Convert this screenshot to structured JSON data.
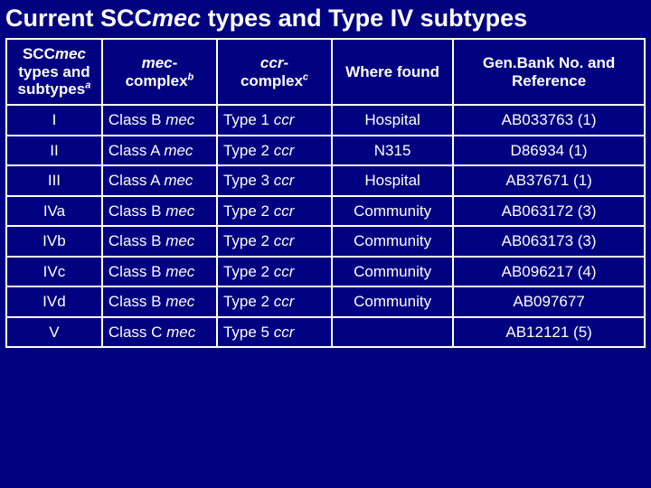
{
  "title": {
    "pre": "Current SCC",
    "mec": "mec",
    "post": " types and Type IV subtypes"
  },
  "headers": {
    "h0": {
      "pre": "SCC",
      "it": "mec",
      "br": "types and subtypes",
      "sup": "a"
    },
    "h1": {
      "it": "mec",
      "dash": "-",
      "line2": "complex",
      "sup": "b"
    },
    "h2": {
      "it": "ccr",
      "dash": "-",
      "line2": "complex",
      "sup": "c"
    },
    "h3": "Where found",
    "h4": "Gen.Bank No. and Reference"
  },
  "rows": [
    {
      "type": "I",
      "mec_class": "Class B",
      "ccr_type": "Type 1",
      "where": "Hospital",
      "ref": "AB033763 (1)"
    },
    {
      "type": "II",
      "mec_class": "Class A",
      "ccr_type": "Type 2",
      "where": "N315",
      "ref": "D86934 (1)"
    },
    {
      "type": "III",
      "mec_class": "Class A",
      "ccr_type": "Type 3",
      "where": "Hospital",
      "ref": "AB37671 (1)"
    },
    {
      "type": "IVa",
      "mec_class": "Class B",
      "ccr_type": "Type 2",
      "where": "Community",
      "ref": "AB063172 (3)"
    },
    {
      "type": "IVb",
      "mec_class": "Class B",
      "ccr_type": "Type 2",
      "where": "Community",
      "ref": "AB063173 (3)"
    },
    {
      "type": "IVc",
      "mec_class": "Class B",
      "ccr_type": "Type 2",
      "where": "Community",
      "ref": "AB096217 (4)"
    },
    {
      "type": "IVd",
      "mec_class": "Class B",
      "ccr_type": "Type 2",
      "where": "Community",
      "ref": "AB097677"
    },
    {
      "type": "V",
      "mec_class": "Class C",
      "ccr_type": "Type 5",
      "where": "",
      "ref": "AB12121 (5)"
    }
  ],
  "italic_labels": {
    "mec": "mec",
    "ccr": "ccr"
  }
}
